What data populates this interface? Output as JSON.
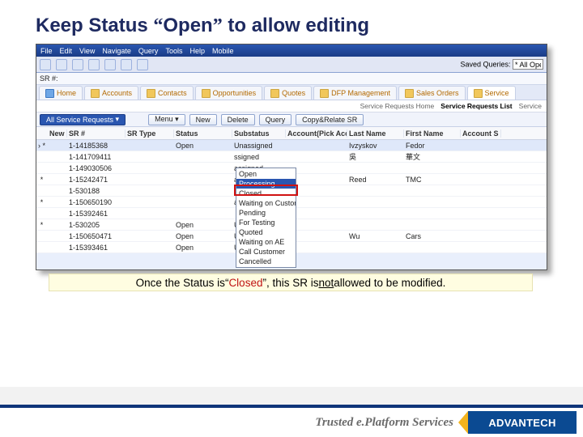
{
  "slide": {
    "title_pre": "Keep Status ",
    "title_q1": "“",
    "title_word": "Open",
    "title_q2": "”",
    "title_post": " to allow editing",
    "note_pre": "Once the Status is ",
    "note_q1": "“",
    "note_closed": "Closed",
    "note_q2": "”",
    "note_mid": ", this SR is ",
    "note_not": "not",
    "note_post": " allowed to be modified."
  },
  "footer": {
    "tagline": "Trusted e.Platform Services",
    "logo": "ADVANTECH"
  },
  "crm": {
    "menu": [
      "File",
      "Edit",
      "View",
      "Navigate",
      "Query",
      "Tools",
      "Help",
      "Mobile"
    ],
    "saved_label": "Saved Queries:",
    "saved_value": "* All Ope",
    "sr_label": "SR #:",
    "tabs": [
      "Home",
      "Accounts",
      "Contacts",
      "Opportunities",
      "Quotes",
      "DFP Management",
      "Sales Orders",
      "Service"
    ],
    "sub_links": [
      "Service Requests Home",
      "Service Requests List",
      "Service"
    ],
    "view_label": "All Service Requests",
    "menu_btn": "Menu ▾",
    "actions": [
      "New",
      "Delete",
      "Query"
    ],
    "copy_btn": "Copy&Relate SR",
    "headers": [
      "",
      "New",
      "SR #",
      "SR Type",
      "Status",
      "Substatus",
      "Account(Pick Acc",
      "Last Name",
      "First Name",
      "Account S"
    ],
    "rows": [
      {
        "mark": "› *",
        "new": "",
        "sr": "1-14185368",
        "type": "",
        "status": "Open",
        "sub": "Unassigned",
        "acct": "",
        "last": "Ivzyskov",
        "first": "Fedor",
        "as": ""
      },
      {
        "mark": "",
        "new": "",
        "sr": "1-141709411",
        "type": "",
        "status": "",
        "sub": "ssigned",
        "acct": "",
        "last": "吳",
        "first": "華文",
        "as": ""
      },
      {
        "mark": "",
        "new": "",
        "sr": "1-149030506",
        "type": "",
        "status": "",
        "sub": "assigned",
        "acct": "",
        "last": "",
        "first": "",
        "as": ""
      },
      {
        "mark": "*",
        "new": "",
        "sr": "1-15242471",
        "type": "",
        "status": "",
        "sub": "assigned",
        "acct": "",
        "last": "Reed",
        "first": "TMC",
        "as": ""
      },
      {
        "mark": "",
        "new": "",
        "sr": "1-530188",
        "type": "",
        "status": "",
        "sub": "assigned",
        "acct": "",
        "last": "",
        "first": "",
        "as": ""
      },
      {
        "mark": "*",
        "new": "",
        "sr": "1-150650190",
        "type": "",
        "status": "",
        "sub": "assigned",
        "acct": "",
        "last": "",
        "first": "",
        "as": ""
      },
      {
        "mark": "",
        "new": "",
        "sr": "1-15392461",
        "type": "",
        "status": "",
        "sub": "",
        "acct": "",
        "last": "",
        "first": "",
        "as": ""
      },
      {
        "mark": "*",
        "new": "",
        "sr": "1-530205",
        "type": "",
        "status": "Open",
        "sub": "Unassigned",
        "acct": "",
        "last": "",
        "first": "",
        "as": ""
      },
      {
        "mark": "",
        "new": "",
        "sr": "1-150650471",
        "type": "",
        "status": "Open",
        "sub": "Unassigned",
        "acct": "",
        "last": "Wu",
        "first": "Cars",
        "as": ""
      },
      {
        "mark": "",
        "new": "",
        "sr": "1-15393461",
        "type": "",
        "status": "Open",
        "sub": "Unassigned",
        "acct": "",
        "last": "",
        "first": "",
        "as": ""
      }
    ],
    "dropdown": [
      "Open",
      "Processing",
      "Closed",
      "Waiting on Custome",
      "Pending",
      "For Testing",
      "Quoted",
      "Waiting on AE",
      "Call Customer",
      "Cancelled"
    ]
  }
}
